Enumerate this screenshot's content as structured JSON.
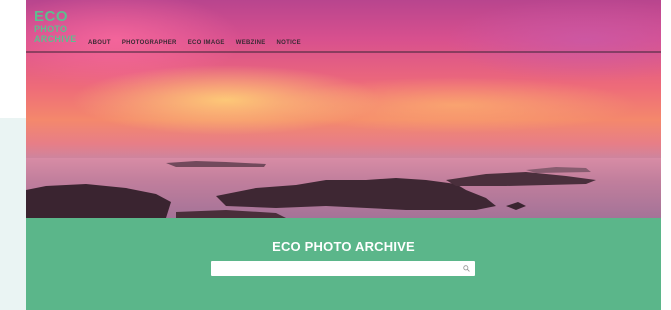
{
  "logo": {
    "line1": "ECO",
    "line2": "PHOTO",
    "line3": "ARCHIVE"
  },
  "nav": {
    "items": [
      {
        "label": "ABOUT"
      },
      {
        "label": "PHOTOGRAPHER"
      },
      {
        "label": "ECO IMAGE"
      },
      {
        "label": "WEBZINE"
      },
      {
        "label": "NOTICE"
      }
    ]
  },
  "hero": {
    "image": "sunset-over-islands"
  },
  "search_section": {
    "title": "ECO PHOTO ARCHIVE",
    "input_value": "",
    "placeholder": "",
    "icon": "search-icon"
  },
  "colors": {
    "brand_green": "#5bb68a",
    "logo_green": "#5fbd8f",
    "side_panel": "#eaf4f3"
  }
}
